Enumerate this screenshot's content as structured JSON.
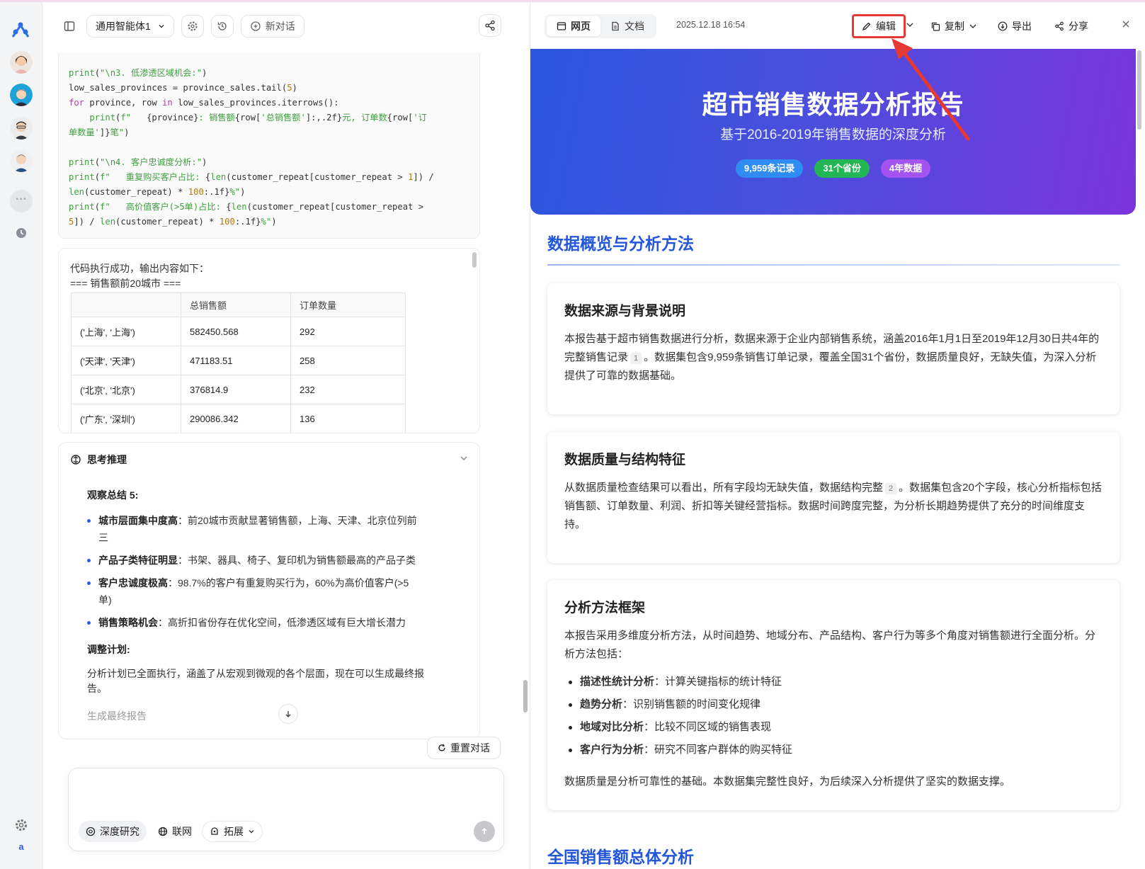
{
  "rail": {
    "user_initial": "a"
  },
  "chat": {
    "agent_name": "通用智能体1",
    "new_chat": "新对话",
    "code_lines": [
      "print(\"\\n3. 低渗透区域机会:\")",
      "low_sales_provinces = province_sales.tail(5)",
      "for province, row in low_sales_provinces.iterrows():",
      "    print(f\"   {province}: 销售额{row['总销售额']:,.2f}元, 订单数{row['订",
      "单数量']}笔\")",
      "",
      "print(\"\\n4. 客户忠诚度分析:\")",
      "print(f\"   重复购买客户占比: {len(customer_repeat[customer_repeat > 1]) /",
      "len(customer_repeat) * 100:.1f}%\")",
      "print(f\"   高价值客户(>5单)占比: {len(customer_repeat[customer_repeat >",
      "5]) / len(customer_repeat) * 100:.1f}%\")"
    ],
    "output": {
      "intro": "代码执行成功，输出内容如下：",
      "heading": "=== 销售额前20城市 ===",
      "columns": [
        "",
        "总销售额",
        "订单数量"
      ],
      "rows": [
        [
          "('上海', '上海')",
          "582450.568",
          "292"
        ],
        [
          "('天津', '天津')",
          "471183.51",
          "258"
        ],
        [
          "('北京', '北京')",
          "376814.9",
          "232"
        ],
        [
          "('广东', '深圳')",
          "290086.342",
          "136"
        ]
      ]
    },
    "thinking": {
      "title": "思考推理",
      "observation_title": "观察总结 5:",
      "items": [
        {
          "bold": "城市层面集中度高",
          "text": "：前20城市贡献显著销售额，上海、天津、北京位列前三"
        },
        {
          "bold": "产品子类特征明显",
          "text": "：书架、器具、椅子、复印机为销售额最高的产品子类"
        },
        {
          "bold": "客户忠诚度极高",
          "text": "：98.7%的客户有重复购买行为，60%为高价值客户(>5单)"
        },
        {
          "bold": "销售策略机会",
          "text": "：高折扣省份存在优化空间，低渗透区域有巨大增长潜力"
        }
      ],
      "adjust_title": "调整计划:",
      "plan_text": "分析计划已全面执行，涵盖了从宏观到微观的各个层面，现在可以生成最终报告。",
      "final_text": "生成最终报告"
    },
    "reset_label": "重置对话",
    "input_placeholder": "",
    "chips": {
      "deep_research": "深度研究",
      "web": "联网",
      "extend": "拓展"
    }
  },
  "preview": {
    "tabs": {
      "web": "网页",
      "doc": "文档"
    },
    "timestamp": "2025.12.18 16:54",
    "actions": {
      "edit": "编辑",
      "copy": "复制",
      "export": "导出",
      "share": "分享"
    },
    "hero": {
      "title": "超市销售数据分析报告",
      "subtitle": "基于2016-2019年销售数据的深度分析",
      "badges": [
        {
          "label": "9,959条记录",
          "color": "#2f8cf3"
        },
        {
          "label": "31个省份",
          "color": "#22b654"
        },
        {
          "label": "4年数据",
          "color": "#a353f0"
        }
      ]
    },
    "section1": "数据概览与分析方法",
    "card1": {
      "title": "数据来源与背景说明",
      "text_a": "本报告基于超市销售数据进行分析，数据来源于企业内部销售系统，涵盖2016年1月1日至2019年12月30日共4年的完整销售记录",
      "ref": "1",
      "text_b": "。数据集包含9,959条销售订单记录，覆盖全国31个省份，数据质量良好，无缺失值，为深入分析提供了可靠的数据基础。"
    },
    "card2": {
      "title": "数据质量与结构特征",
      "text_a": "从数据质量检查结果可以看出，所有字段均无缺失值，数据结构完整",
      "ref": "2",
      "text_b": "。数据集包含20个字段，核心分析指标包括销售额、订单数量、利润、折扣等关键经营指标。数据时间跨度完整，为分析长期趋势提供了充分的时间维度支持。"
    },
    "card3": {
      "title": "分析方法框架",
      "intro": "本报告采用多维度分析方法，从时间趋势、地域分布、产品结构、客户行为等多个角度对销售额进行全面分析。分析方法包括：",
      "items": [
        {
          "bold": "描述性统计分析",
          "text": "：计算关键指标的统计特征"
        },
        {
          "bold": "趋势分析",
          "text": "：识别销售额的时间变化规律"
        },
        {
          "bold": "地域对比分析",
          "text": "：比较不同区域的销售表现"
        },
        {
          "bold": "客户行为分析",
          "text": "：研究不同客户群体的购买特征"
        }
      ],
      "outro": "数据质量是分析可靠性的基础。本数据集完整性良好，为后续深入分析提供了坚实的数据支撑。"
    },
    "section2": "全国销售额总体分析"
  }
}
